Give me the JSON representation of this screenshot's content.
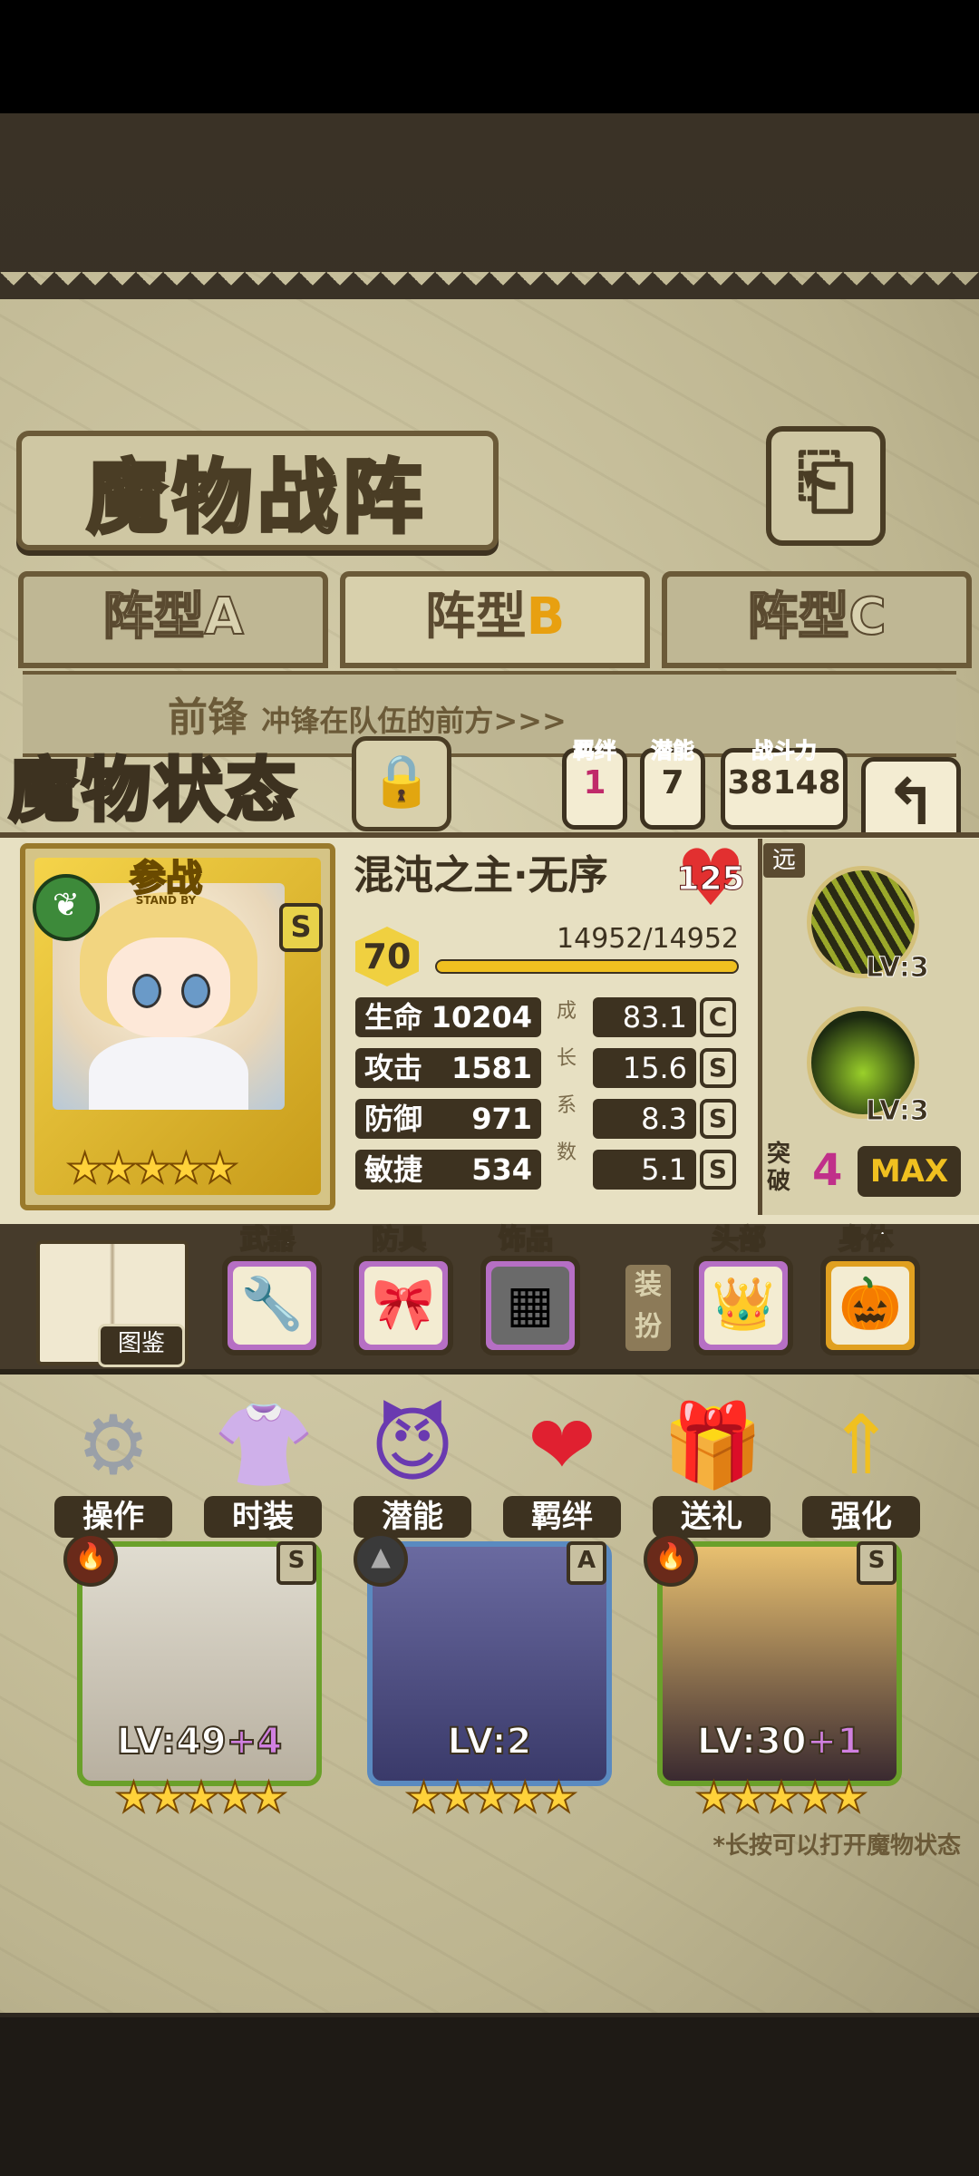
{
  "screen": {
    "title": "魔物战阵",
    "tabs": [
      {
        "label_main": "阵型",
        "label_letter": "A"
      },
      {
        "label_main": "阵型",
        "label_letter": "B"
      },
      {
        "label_main": "阵型",
        "label_letter": "C"
      }
    ],
    "active_tab": "阵型B",
    "front_row_label": "前锋",
    "front_row_desc": "冲锋在队伍的前方>>>",
    "hint": "*长按可以打开魔物状态"
  },
  "status_panel": {
    "title": "魔物状态",
    "bond": {
      "label": "羁绊",
      "value": "1"
    },
    "potential": {
      "label": "潜能",
      "value": "7"
    },
    "power": {
      "label": "战斗力",
      "value": "38148"
    },
    "card": {
      "standby_label": "参战",
      "standby_sub": "STAND BY",
      "rank": "S",
      "stars": "★★★★★"
    },
    "name": "混沌之主·无序",
    "affection": "125",
    "level": "70",
    "hp_text": "14952/14952",
    "hp_fraction": 1.0,
    "attributes": [
      {
        "label": "生命",
        "value": "10204",
        "growth": "83.1",
        "grade": "C"
      },
      {
        "label": "攻击",
        "value": "1581",
        "growth": "15.6",
        "grade": "S"
      },
      {
        "label": "防御",
        "value": "971",
        "growth": "8.3",
        "grade": "S"
      },
      {
        "label": "敏捷",
        "value": "534",
        "growth": "5.1",
        "grade": "S"
      }
    ],
    "growth_label_chars": [
      "成",
      "长",
      "系",
      "数"
    ],
    "range": "远",
    "skills": [
      {
        "level": "LV:3"
      },
      {
        "level": "LV:3"
      }
    ],
    "breakthrough": {
      "label": "突破",
      "value": "4",
      "max_label": "MAX"
    },
    "equipment": {
      "codex_label": "图鉴",
      "weapon_label": "武器",
      "armor_label": "防具",
      "accessory_label": "饰品",
      "swap_label": "装扮",
      "head_label": "头部",
      "body_label": "身体"
    },
    "actions": [
      {
        "label": "操作",
        "icon": "gear-icon"
      },
      {
        "label": "时装",
        "icon": "outfit-icon"
      },
      {
        "label": "潜能",
        "icon": "potential-icon"
      },
      {
        "label": "羁绊",
        "icon": "heart-icon"
      },
      {
        "label": "送礼",
        "icon": "gift-icon"
      },
      {
        "label": "强化",
        "icon": "upgrade-arrows-icon"
      }
    ]
  },
  "lineup": [
    {
      "level": "LV:49",
      "bonus": "+4",
      "grade": "S",
      "stars": "★★★★★"
    },
    {
      "level": "LV:2",
      "bonus": "",
      "grade": "A",
      "stars": "★★★★★"
    },
    {
      "level": "LV:30",
      "bonus": "+1",
      "grade": "S",
      "stars": "★★★★★"
    }
  ]
}
